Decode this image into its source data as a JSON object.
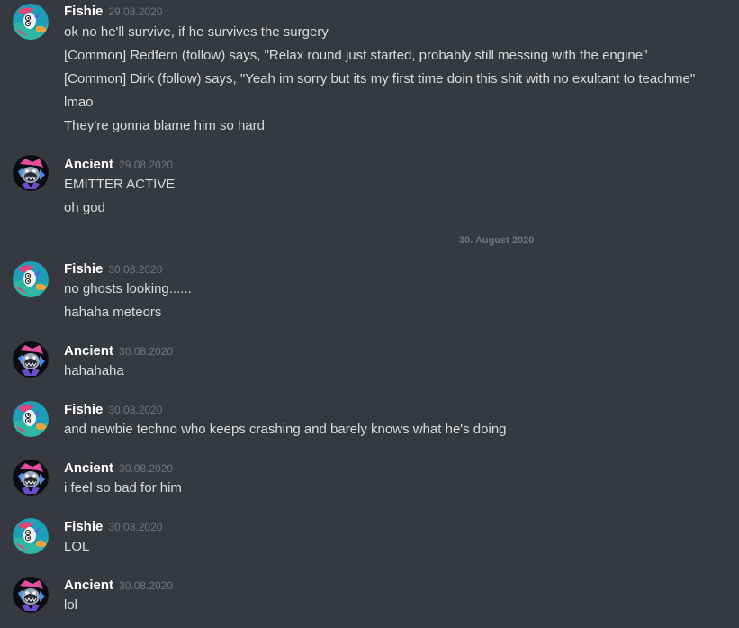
{
  "groups": [
    {
      "username": "Fishie",
      "timestamp": "29.08.2020",
      "avatar": "fishie-avatar",
      "messages": [
        "ok no he'll survive, if he survives the surgery",
        "[Common] Redfern (follow) says, \"Relax round just started, probably still messing with the engine\"",
        "[Common] Dirk (follow) says, \"Yeah im sorry but its my first time doin this shit with no exultant to teachme\"",
        "lmao",
        "They're gonna blame him so hard"
      ]
    },
    {
      "username": "Ancient",
      "timestamp": "29.08.2020",
      "avatar": "ancient-avatar",
      "messages": [
        "EMITTER ACTIVE",
        "oh god"
      ]
    },
    {
      "username": "Fishie",
      "timestamp": "30.08.2020",
      "avatar": "fishie-avatar",
      "messages": [
        "no ghosts looking......",
        "hahaha meteors"
      ]
    },
    {
      "username": "Ancient",
      "timestamp": "30.08.2020",
      "avatar": "ancient-avatar",
      "messages": [
        "hahahaha"
      ]
    },
    {
      "username": "Fishie",
      "timestamp": "30.08.2020",
      "avatar": "fishie-avatar",
      "messages": [
        "and newbie techno who keeps crashing and barely knows what he's doing"
      ]
    },
    {
      "username": "Ancient",
      "timestamp": "30.08.2020",
      "avatar": "ancient-avatar",
      "messages": [
        "i feel so bad for him"
      ]
    },
    {
      "username": "Fishie",
      "timestamp": "30.08.2020",
      "avatar": "fishie-avatar",
      "messages": [
        "LOL"
      ]
    },
    {
      "username": "Ancient",
      "timestamp": "30.08.2020",
      "avatar": "ancient-avatar",
      "messages": [
        "lol"
      ]
    }
  ],
  "date_divider": "30. August 2020",
  "colors": {
    "background": "#36393f",
    "username": "#ffffff",
    "message_text": "#dcddde",
    "timestamp": "#72767d"
  }
}
